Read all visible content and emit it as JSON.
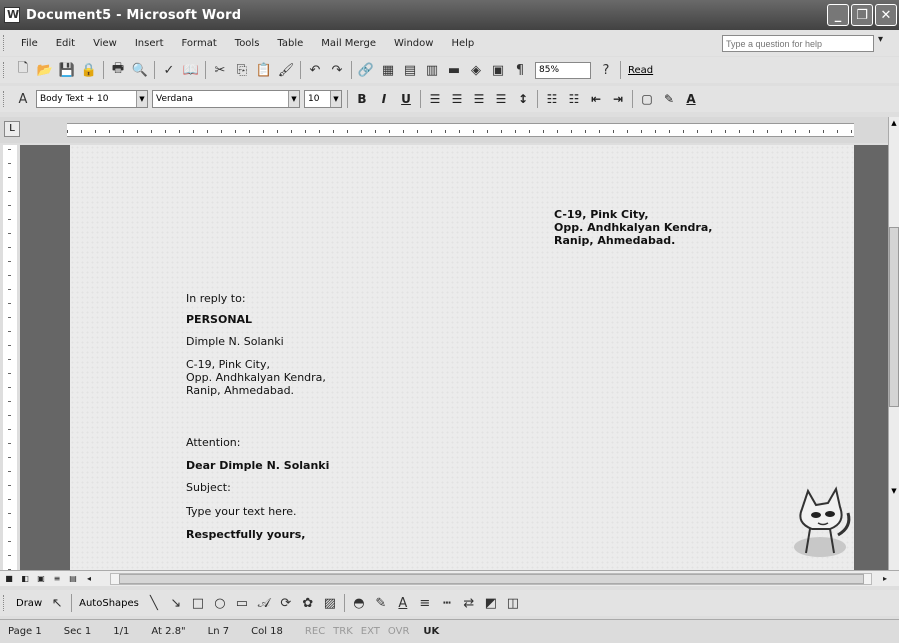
{
  "window": {
    "title": "Document5 - Microsoft Word"
  },
  "menu": {
    "items": [
      "File",
      "Edit",
      "View",
      "Insert",
      "Format",
      "Tools",
      "Table",
      "Mail Merge",
      "Window",
      "Help"
    ],
    "help_placeholder": "Type a question for help"
  },
  "toolbar": {
    "zoom": "85%",
    "read_label": "Read"
  },
  "format": {
    "style": "Body Text + 10",
    "font": "Verdana",
    "size": "10"
  },
  "document": {
    "sender_lines": [
      "C-19, Pink City,",
      "Opp. Andhkalyan Kendra,",
      "Ranip, Ahmedabad."
    ],
    "reply_to": "In reply to:",
    "personal": "PERSONAL",
    "recipient_name": "Dimple N. Solanki",
    "recipient_address": [
      "C-19, Pink City,",
      "Opp. Andhkalyan Kendra,",
      "Ranip, Ahmedabad."
    ],
    "attention": "Attention:",
    "salutation": "Dear Dimple N. Solanki",
    "subject": "Subject:",
    "body": "Type your text here.",
    "closing": "Respectfully yours,"
  },
  "drawbar": {
    "draw_label": "Draw",
    "autoshapes_label": "AutoShapes"
  },
  "status": {
    "page": "Page 1",
    "section": "Sec 1",
    "page_of": "1/1",
    "at": "At 2.8\"",
    "line": "Ln 7",
    "col": "Col 18",
    "rec": "REC",
    "trk": "TRK",
    "ext": "EXT",
    "ovr": "OVR",
    "lang": "UK"
  }
}
